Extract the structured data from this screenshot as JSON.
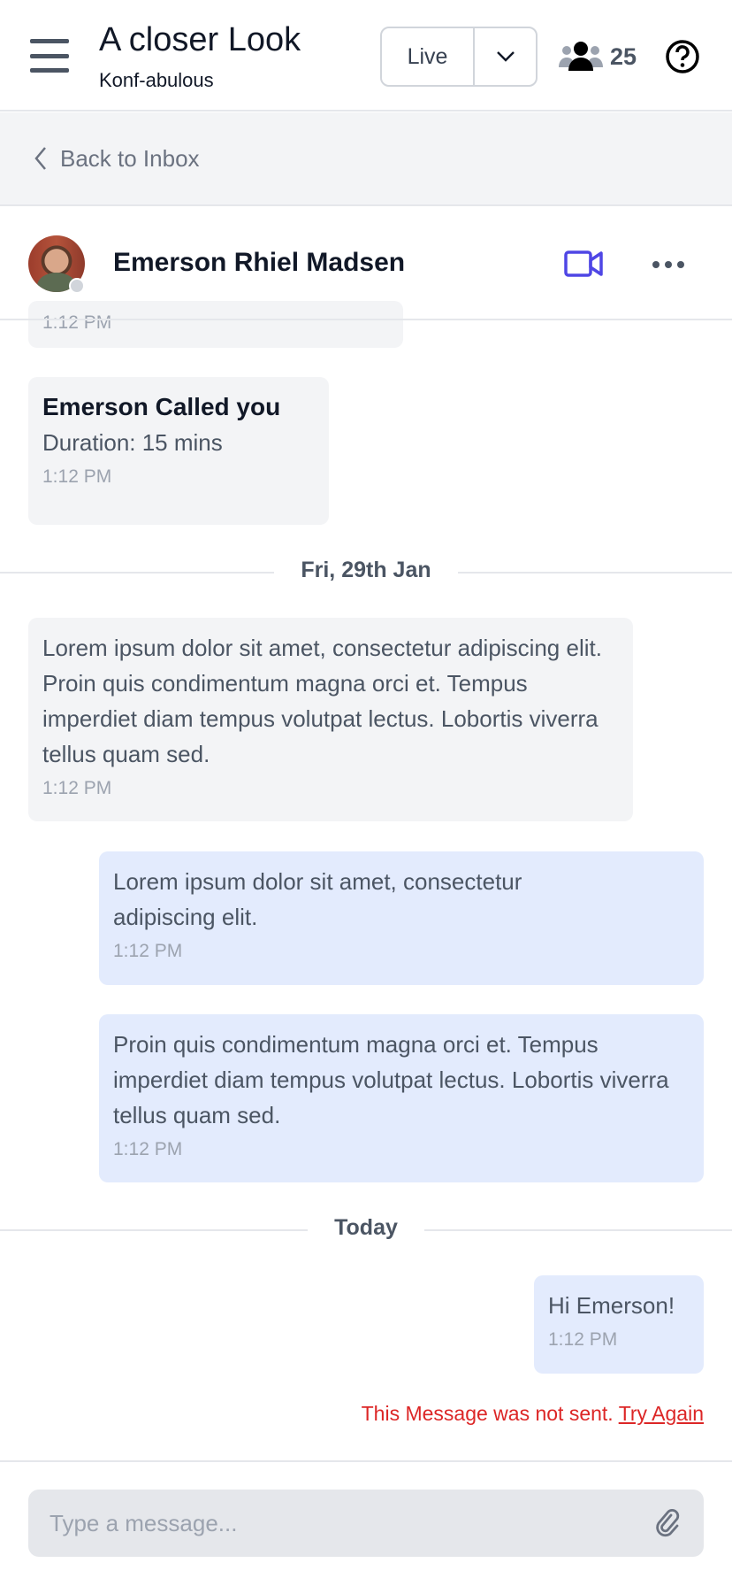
{
  "header": {
    "title": "A closer Look",
    "subtitle": "Konf-abulous",
    "live_label": "Live",
    "attendee_count": "25"
  },
  "nav": {
    "back_label": "Back to Inbox"
  },
  "contact": {
    "name": "Emerson Rhiel Madsen",
    "status": "offline",
    "accent": "#4f46e5"
  },
  "messages": {
    "partial_time": "1:12 PM",
    "call": {
      "title": "Emerson Called you",
      "duration": "Duration: 15 mins",
      "time": "1:12 PM"
    },
    "date1": "Fri, 29th Jan",
    "m1": {
      "text": "Lorem ipsum dolor sit amet, consectetur adipiscing elit. Proin quis condimentum magna orci et. Tempus imperdiet diam tempus volutpat lectus. Lobortis viverra tellus quam sed.",
      "time": "1:12 PM"
    },
    "m2": {
      "text": "Lorem ipsum dolor sit amet, consectetur adipiscing elit.",
      "time": "1:12 PM"
    },
    "m3": {
      "text": "Proin quis condimentum magna orci et. Tempus imperdiet diam tempus volutpat lectus. Lobortis viverra tellus quam sed.",
      "time": "1:12 PM"
    },
    "date2": "Today",
    "m4": {
      "text": "Hi Emerson!",
      "time": "1:12 PM"
    },
    "error": "This Message was not sent.",
    "retry": "Try Again"
  },
  "composer": {
    "placeholder": "Type a message..."
  }
}
